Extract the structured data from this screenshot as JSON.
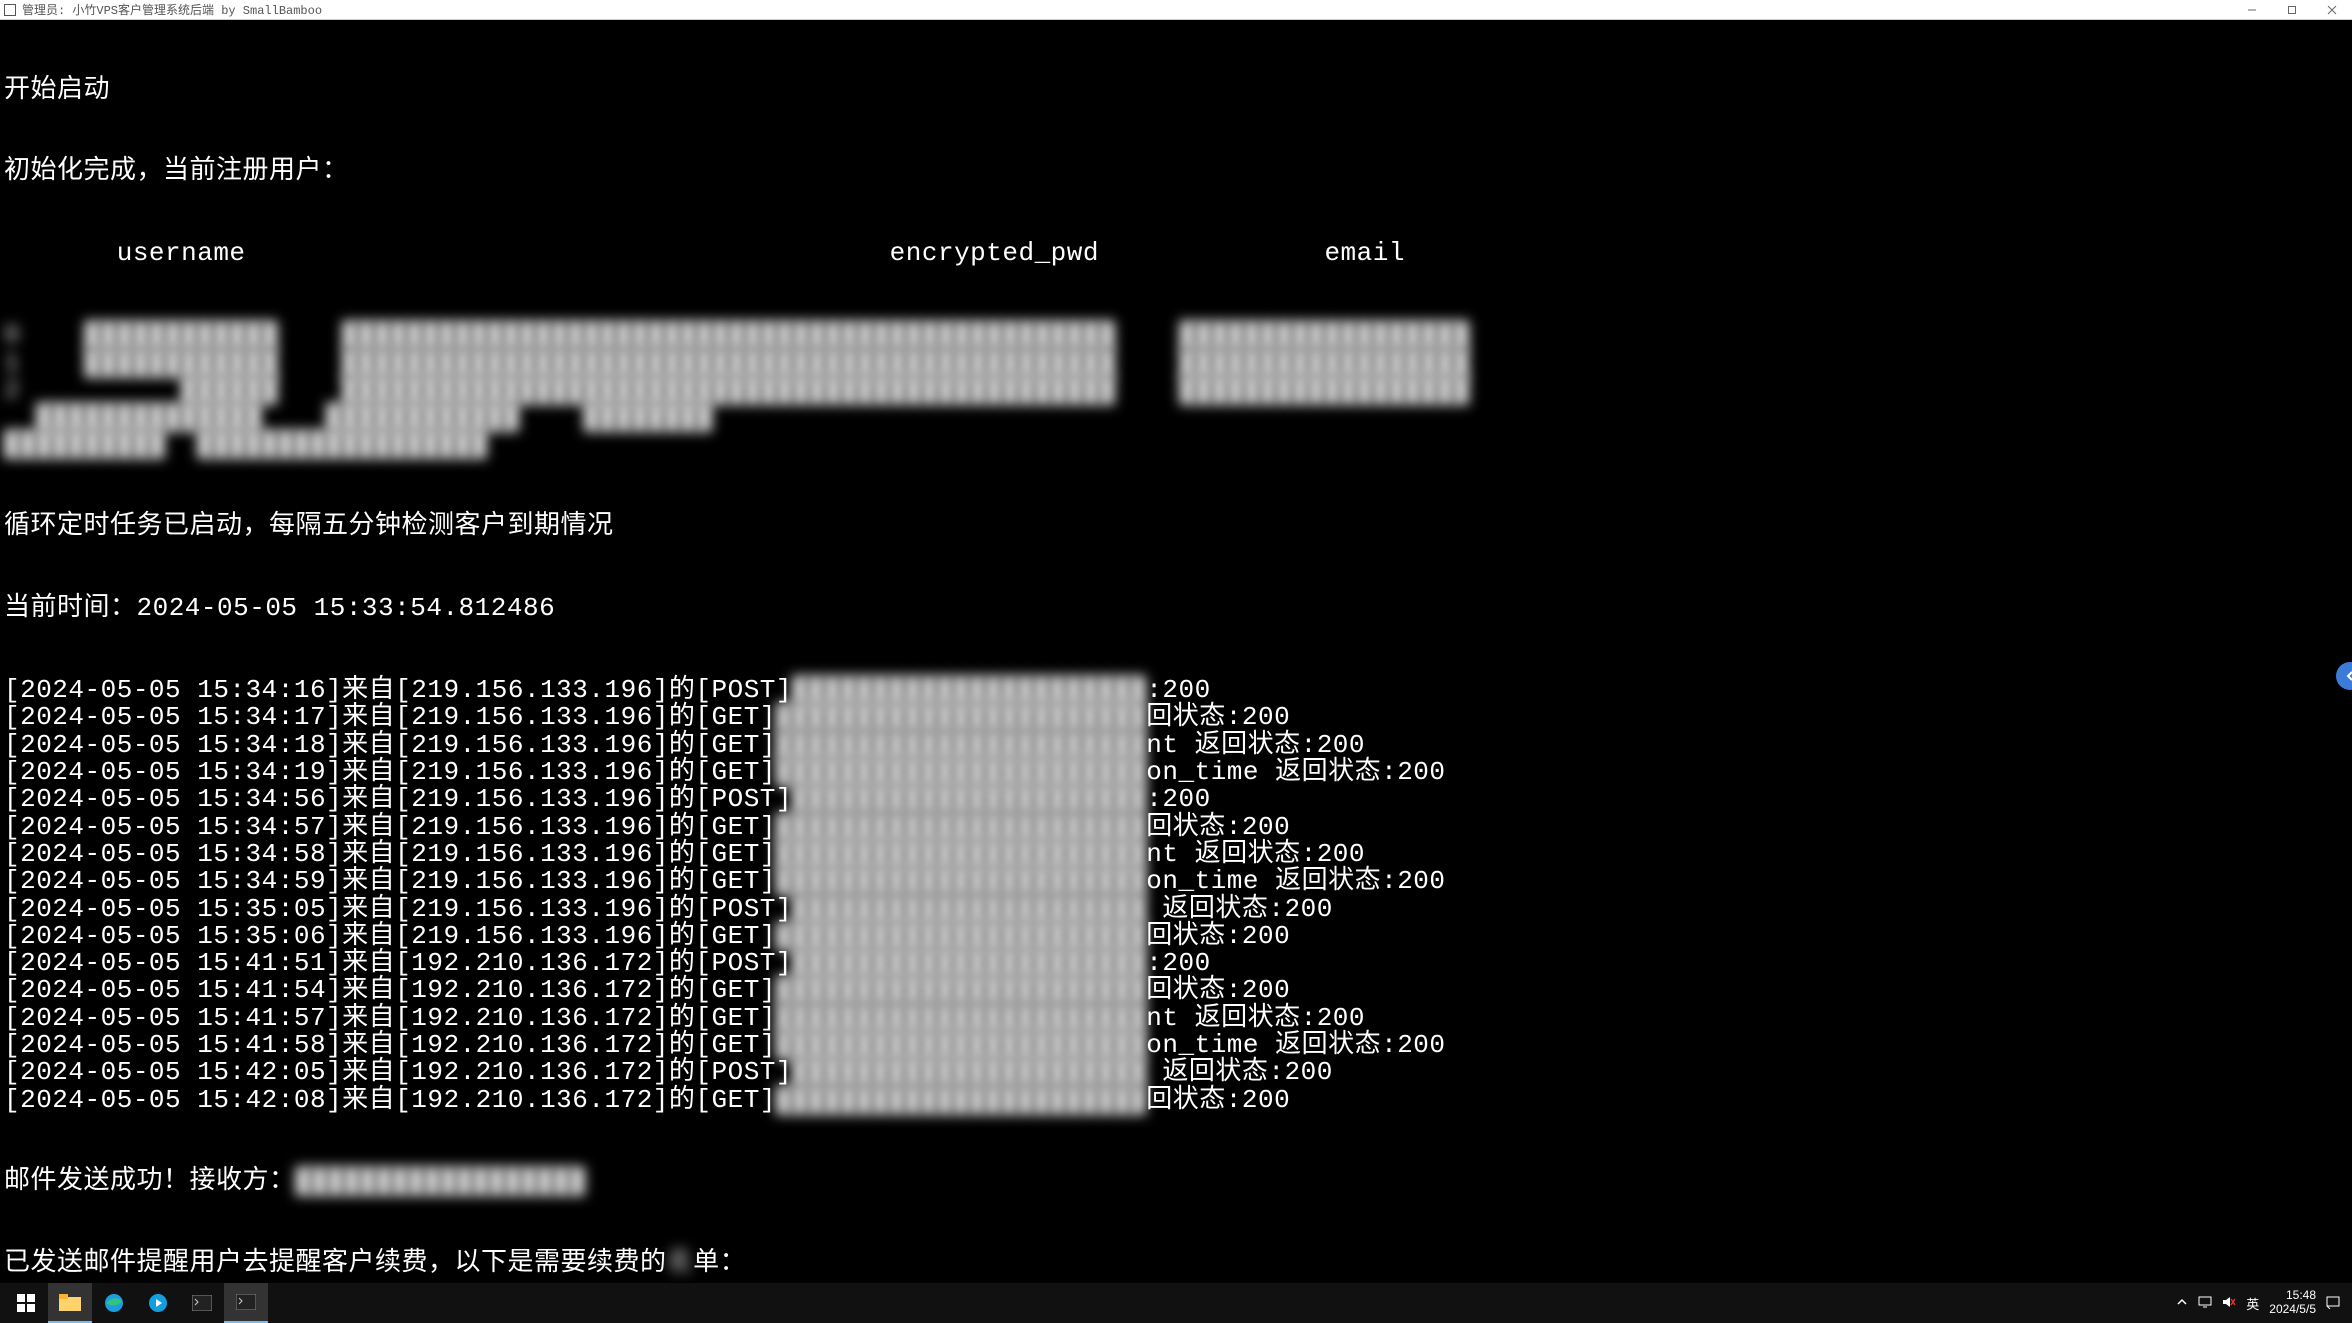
{
  "window": {
    "title": "管理员:  小竹VPS客户管理系统后端 by SmallBamboo"
  },
  "terminal": {
    "start_line": "开始启动",
    "init_line": "初始化完成，当前注册用户：",
    "table_headers": {
      "username": "username",
      "encrypted_pwd": "encrypted_pwd",
      "email": "email"
    },
    "blurred_user_rows": [
      "0    ████████████    ████████████████████████████████████████████████    ██████████████████",
      "1    ████████████    ████████████████████████████████████████████████    ██████████████████",
      "2          ██████    ████████████████████████████████████████████████    ██████████████████",
      "  ██████████████    ████████████    ████████",
      "██████████  ██████████████████"
    ],
    "loop_line": "循环定时任务已启动，每隔五分钟检测客户到期情况",
    "time_line": "当前时间：2024-05-05 15:33:54.812486",
    "log_rows": [
      {
        "ts": "2024-05-05 15:34:16",
        "ip": "219.156.133.196",
        "method": "POST",
        "mid": "██████████████████████",
        "tail": ":200"
      },
      {
        "ts": "2024-05-05 15:34:17",
        "ip": "219.156.133.196",
        "method": "GET",
        "mid": "███████████████████████",
        "tail": "回状态:200"
      },
      {
        "ts": "2024-05-05 15:34:18",
        "ip": "219.156.133.196",
        "method": "GET",
        "mid": "███████████████████████",
        "tail": "nt 返回状态:200"
      },
      {
        "ts": "2024-05-05 15:34:19",
        "ip": "219.156.133.196",
        "method": "GET",
        "mid": "███████████████████████",
        "tail": "on_time 返回状态:200"
      },
      {
        "ts": "2024-05-05 15:34:56",
        "ip": "219.156.133.196",
        "method": "POST",
        "mid": "██████████████████████",
        "tail": ":200"
      },
      {
        "ts": "2024-05-05 15:34:57",
        "ip": "219.156.133.196",
        "method": "GET",
        "mid": "███████████████████████",
        "tail": "回状态:200"
      },
      {
        "ts": "2024-05-05 15:34:58",
        "ip": "219.156.133.196",
        "method": "GET",
        "mid": "███████████████████████",
        "tail": "nt 返回状态:200"
      },
      {
        "ts": "2024-05-05 15:34:59",
        "ip": "219.156.133.196",
        "method": "GET",
        "mid": "███████████████████████",
        "tail": "on_time 返回状态:200"
      },
      {
        "ts": "2024-05-05 15:35:05",
        "ip": "219.156.133.196",
        "method": "POST",
        "mid": "██████████████████████",
        "tail": " 返回状态:200"
      },
      {
        "ts": "2024-05-05 15:35:06",
        "ip": "219.156.133.196",
        "method": "GET",
        "mid": "███████████████████████",
        "tail": "回状态:200"
      },
      {
        "ts": "2024-05-05 15:41:51",
        "ip": "192.210.136.172",
        "method": "POST",
        "mid": "██████████████████████",
        "tail": ":200"
      },
      {
        "ts": "2024-05-05 15:41:54",
        "ip": "192.210.136.172",
        "method": "GET",
        "mid": "███████████████████████",
        "tail": "回状态:200"
      },
      {
        "ts": "2024-05-05 15:41:57",
        "ip": "192.210.136.172",
        "method": "GET",
        "mid": "███████████████████████",
        "tail": "nt 返回状态:200"
      },
      {
        "ts": "2024-05-05 15:41:58",
        "ip": "192.210.136.172",
        "method": "GET",
        "mid": "███████████████████████",
        "tail": "on_time 返回状态:200"
      },
      {
        "ts": "2024-05-05 15:42:05",
        "ip": "192.210.136.172",
        "method": "POST",
        "mid": "██████████████████████",
        "tail": " 返回状态:200"
      },
      {
        "ts": "2024-05-05 15:42:08",
        "ip": "192.210.136.172",
        "method": "GET",
        "mid": "███████████████████████",
        "tail": "回状态:200"
      }
    ],
    "mail_line_prefix": "邮件发送成功！接收方：",
    "mail_line_blur": "██████████████████",
    "renew_line_prefix": "已发送邮件提醒用户去提醒客户续费",
    "renew_line_suffix": "以下是需要续费的",
    "renew_line_tail": "单：",
    "renew_mid_blur": "，",
    "renew_tail_blur": "名"
  },
  "taskbar": {
    "ime": "英",
    "time": "15:48",
    "date": "2024/5/5"
  }
}
